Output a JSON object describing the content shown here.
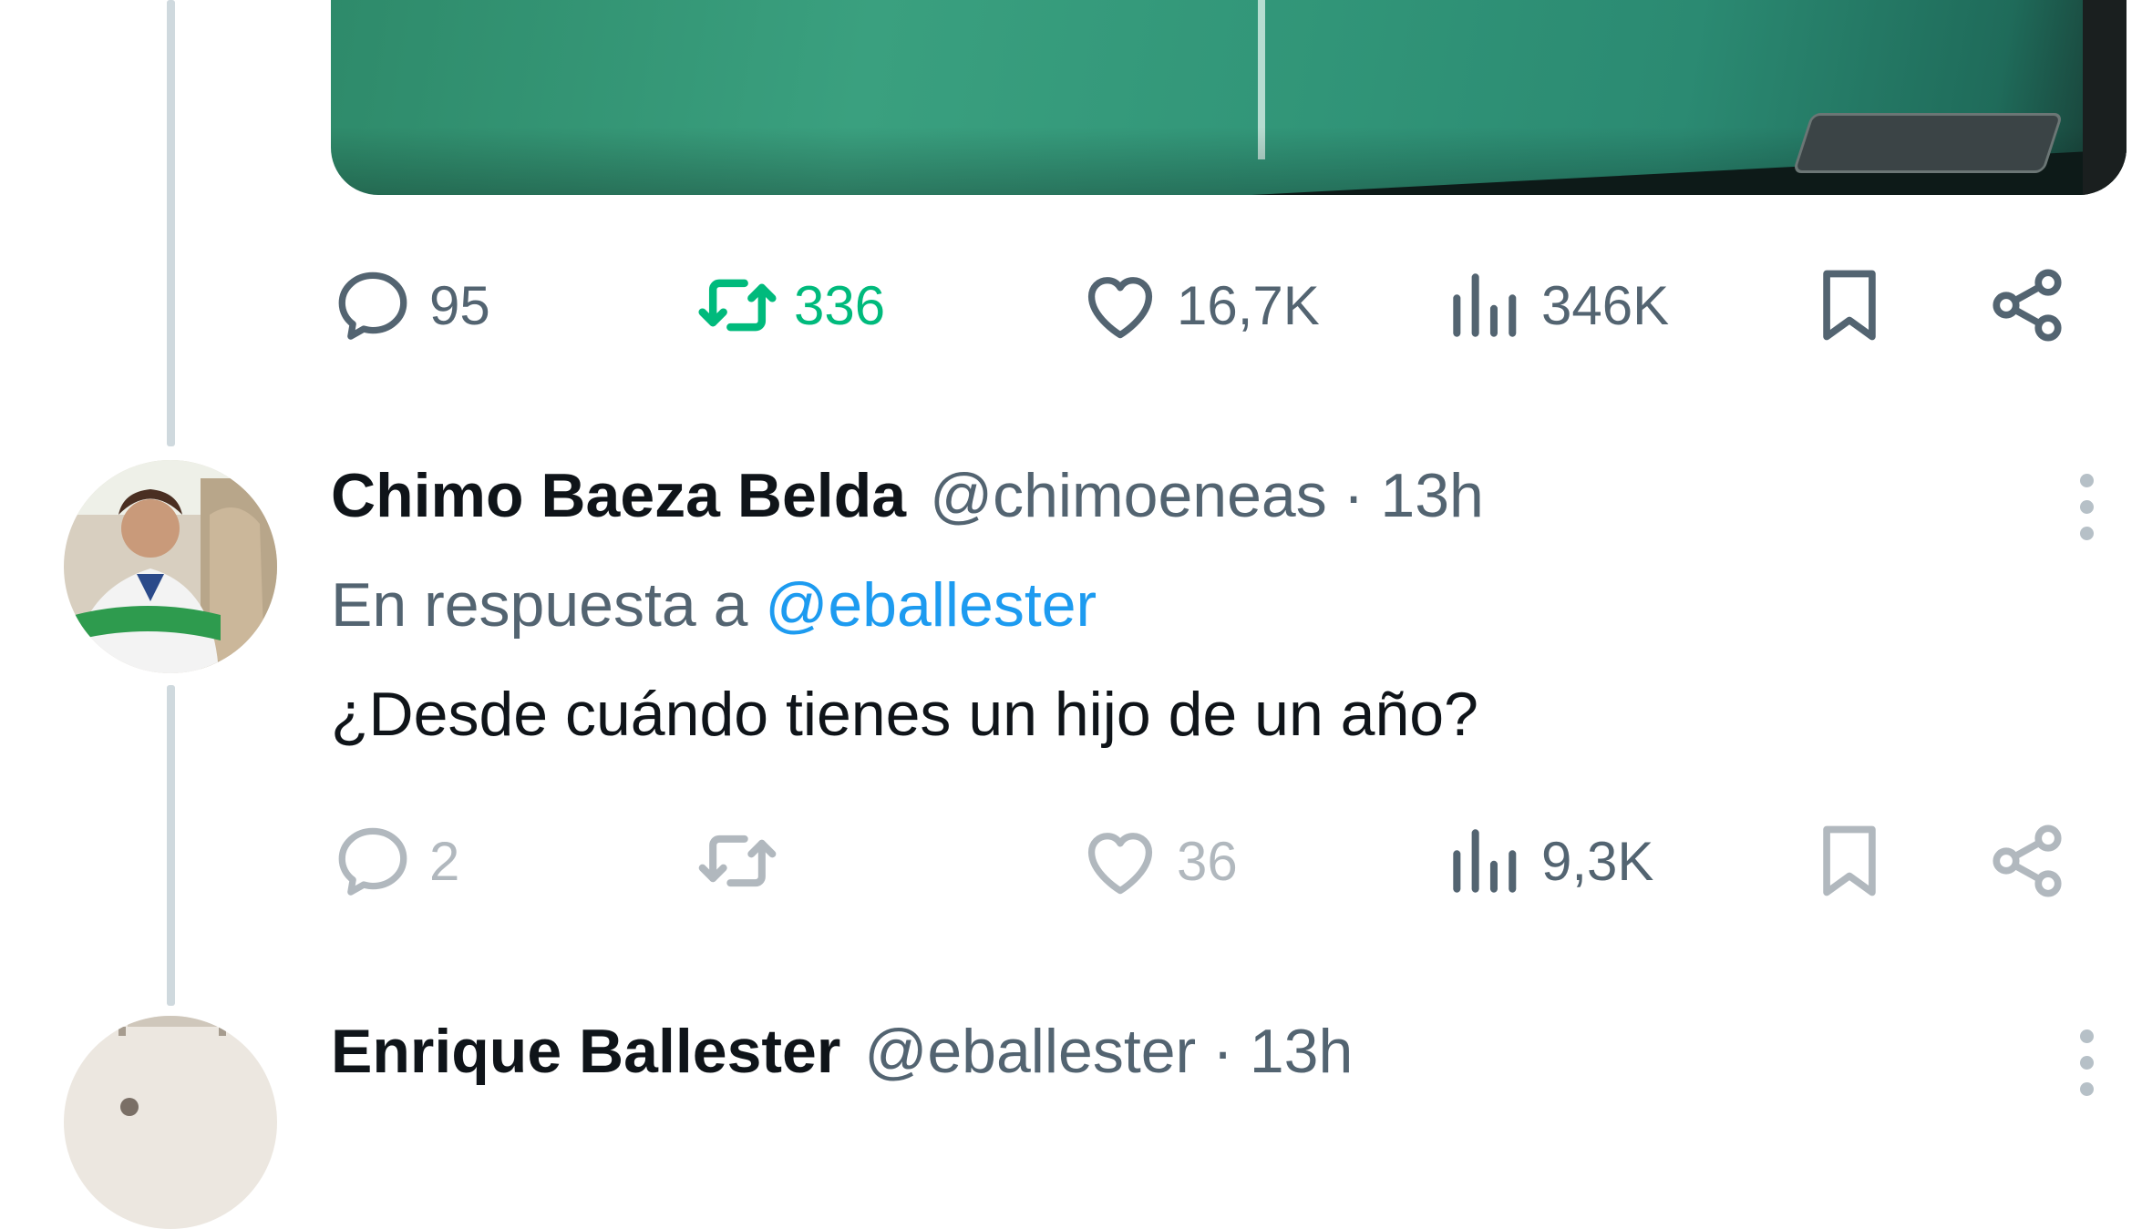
{
  "tweet1": {
    "actions": {
      "reply_count": "95",
      "retweet_count": "336",
      "like_count": "16,7K",
      "view_count": "346K"
    }
  },
  "tweet2": {
    "name": "Chimo Baeza Belda",
    "handle": "@chimoeneas",
    "separator": "·",
    "time": "13h",
    "reply_prefix": "En respuesta a",
    "reply_handle": "@eballester",
    "text": "¿Desde cuándo tienes un hijo de un año?",
    "actions": {
      "reply_count": "2",
      "retweet_count": "",
      "like_count": "36",
      "view_count": "9,3K"
    }
  },
  "tweet3": {
    "name": "Enrique Ballester",
    "handle": "@eballester",
    "separator": "·",
    "time": "13h"
  },
  "colors": {
    "retweet_active": "#00ba7c",
    "link": "#1d9bf0",
    "secondary_text": "#536471",
    "thread_line": "#cfd9de"
  },
  "icons": [
    "reply-icon",
    "retweet-icon",
    "like-icon",
    "views-icon",
    "bookmark-icon",
    "share-icon",
    "more-icon"
  ]
}
